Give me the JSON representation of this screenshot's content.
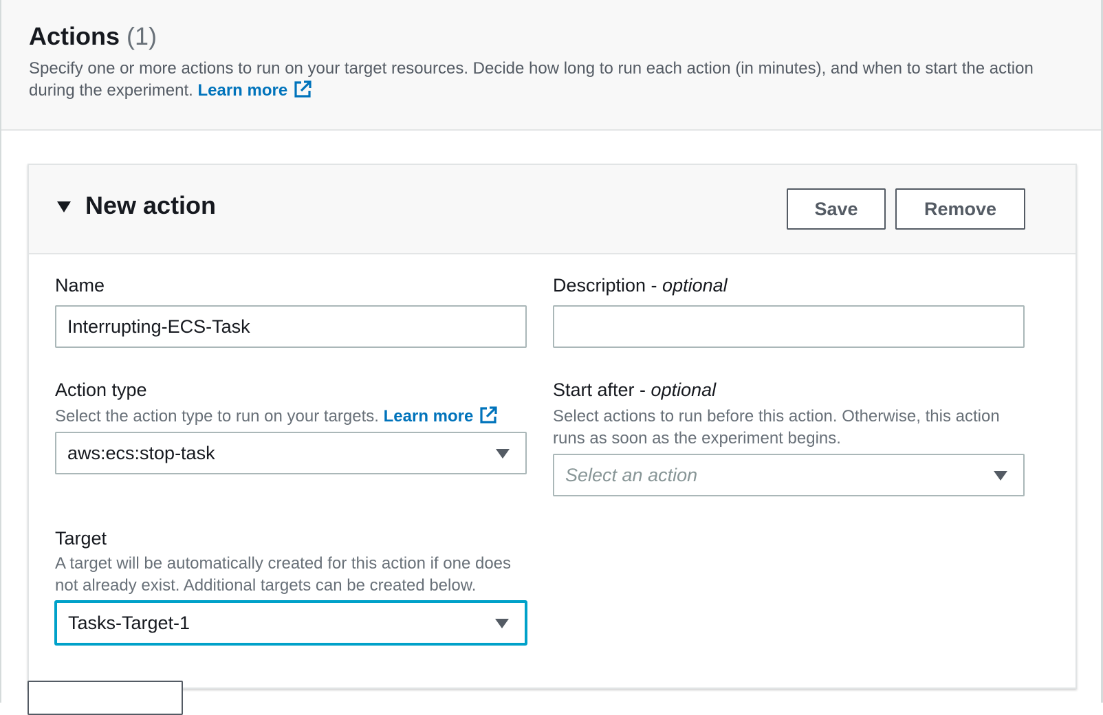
{
  "actions_section": {
    "title": "Actions",
    "count": "(1)",
    "description": "Specify one or more actions to run on your target resources. Decide how long to run each action (in minutes), and when to start the action during the experiment.",
    "learn_more": "Learn more",
    "icon": "external-link-icon"
  },
  "action_card": {
    "expand_icon": "caret-down-icon",
    "title": "New action",
    "save_label": "Save",
    "remove_label": "Remove"
  },
  "form": {
    "name": {
      "label": "Name",
      "value": "Interrupting-ECS-Task"
    },
    "description": {
      "label": "Description - ",
      "label_optional": "optional",
      "value": ""
    },
    "action_type": {
      "label": "Action type",
      "hint": "Select the action type to run on your targets.",
      "learn_more": "Learn more",
      "value": "aws:ecs:stop-task"
    },
    "start_after": {
      "label": "Start after - ",
      "label_optional": "optional",
      "hint": "Select actions to run before this action. Otherwise, this action runs as soon as the experiment begins.",
      "placeholder": "Select an action"
    },
    "target": {
      "label": "Target",
      "hint": "A target will be automatically created for this action if one does not already exist. Additional targets can be created below.",
      "value": "Tasks-Target-1"
    }
  },
  "colors": {
    "link": "#0073bb",
    "focus": "#00a1c9",
    "text": "#16191f",
    "secondary_text": "#687078",
    "header_bg": "#f8f8f8"
  }
}
